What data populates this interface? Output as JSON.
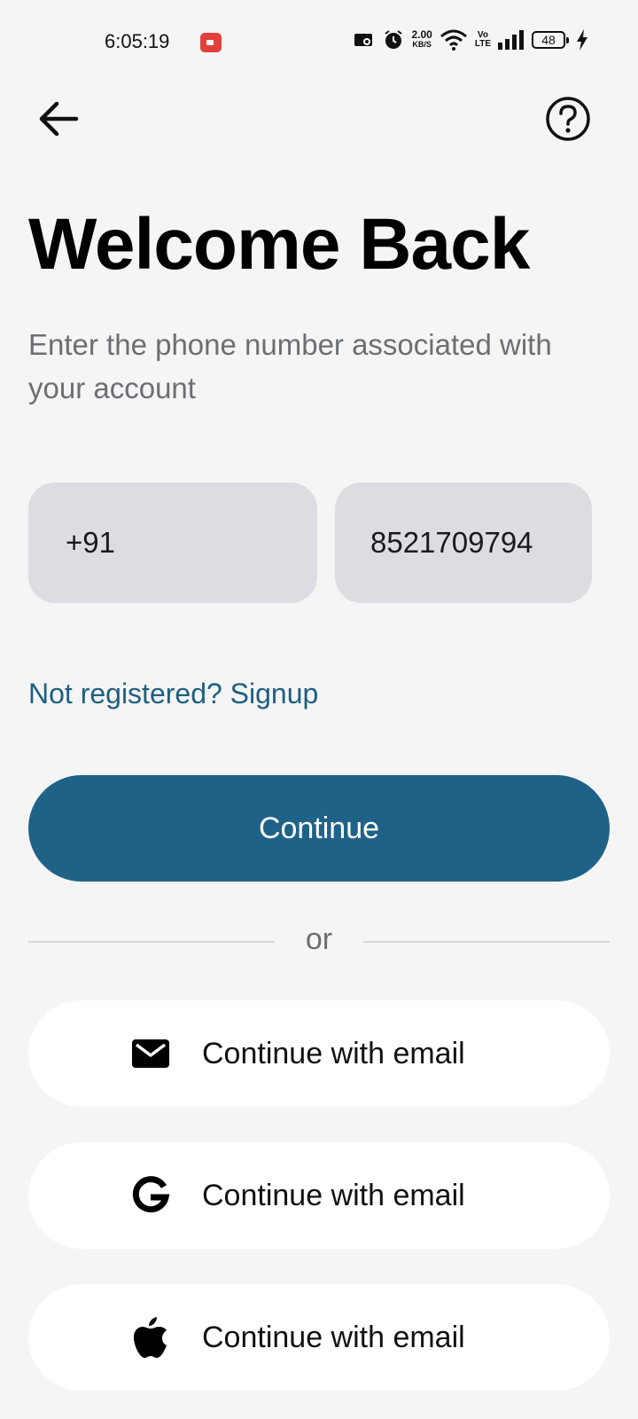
{
  "status_bar": {
    "time": "6:05:19",
    "net_speed_value": "2.00",
    "net_speed_unit": "KB/S",
    "volte_top": "Vo",
    "volte_bottom": "LTE",
    "battery": "48",
    "icons": [
      "screen-record-icon",
      "cast-icon",
      "alarm-icon",
      "wifi-icon",
      "signal-icon",
      "battery-icon",
      "charging-icon"
    ]
  },
  "header": {
    "back_icon": "back-arrow-icon",
    "help_icon": "help-icon"
  },
  "main": {
    "title": "Welcome Back",
    "subtitle": "Enter the phone number associated with your account",
    "country_code": "+91",
    "phone_number": "8521709794",
    "signup_link": "Not registered? Signup",
    "continue_label": "Continue",
    "divider_text": "or"
  },
  "social": [
    {
      "icon": "mail-icon",
      "label": "Continue with email"
    },
    {
      "icon": "google-icon",
      "label": "Continue with email"
    },
    {
      "icon": "apple-icon",
      "label": "Continue with email"
    }
  ],
  "colors": {
    "background": "#f5f5f5",
    "primary": "#1e6387",
    "link": "#1e5f82",
    "field": "#dcdde2",
    "muted_text": "#6b6e73"
  }
}
